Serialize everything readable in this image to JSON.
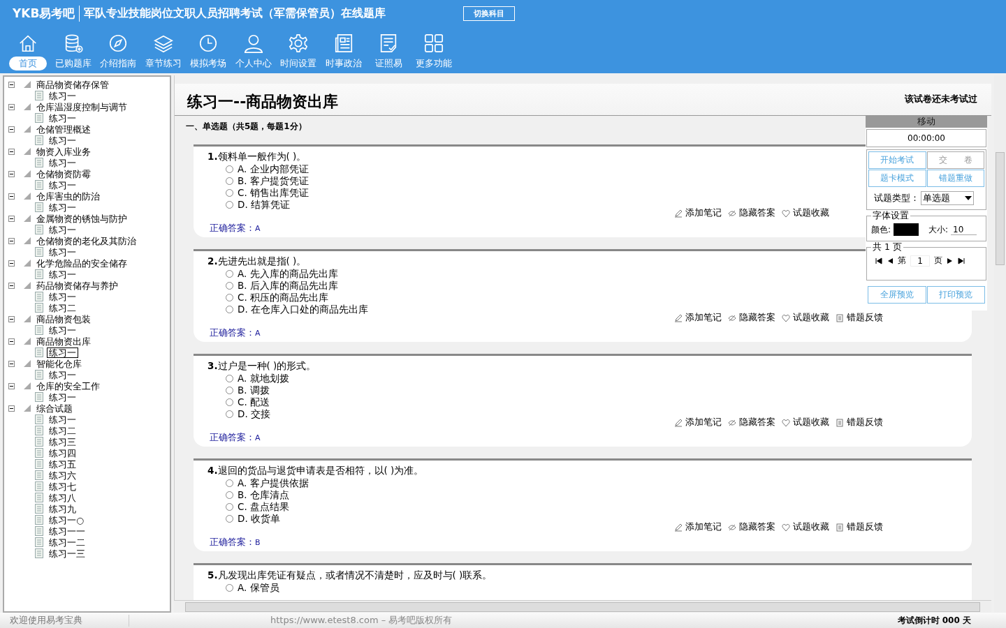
{
  "header": {
    "logo": "YKB易考吧",
    "title": "军队专业技能岗位文职人员招聘考试（军需保管员）在线题库",
    "switch_button": "切换科目"
  },
  "toolbar": [
    {
      "label": "首页",
      "selected": true
    },
    {
      "label": "已购题库",
      "selected": false
    },
    {
      "label": "介绍指南",
      "selected": false
    },
    {
      "label": "章节练习",
      "selected": false
    },
    {
      "label": "模拟考场",
      "selected": false
    },
    {
      "label": "个人中心",
      "selected": false
    },
    {
      "label": "时间设置",
      "selected": false
    },
    {
      "label": "时事政治",
      "selected": false
    },
    {
      "label": "证照易",
      "selected": false
    },
    {
      "label": "更多功能",
      "selected": false
    }
  ],
  "tree": [
    {
      "label": "商品物资储存保管",
      "expanded": true,
      "selected": false,
      "children": [
        {
          "label": "练习一",
          "selected": false
        }
      ]
    },
    {
      "label": "仓库温湿度控制与调节",
      "expanded": true,
      "selected": false,
      "children": [
        {
          "label": "练习一",
          "selected": false
        }
      ]
    },
    {
      "label": "仓储管理概述",
      "expanded": true,
      "selected": false,
      "children": [
        {
          "label": "练习一",
          "selected": false
        }
      ]
    },
    {
      "label": "物资入库业务",
      "expanded": true,
      "selected": false,
      "children": [
        {
          "label": "练习一",
          "selected": false
        }
      ]
    },
    {
      "label": "仓储物资防霉",
      "expanded": true,
      "selected": false,
      "children": [
        {
          "label": "练习一",
          "selected": false
        }
      ]
    },
    {
      "label": "仓库害虫的防治",
      "expanded": true,
      "selected": false,
      "children": [
        {
          "label": "练习一",
          "selected": false
        }
      ]
    },
    {
      "label": "金属物资的锈蚀与防护",
      "expanded": true,
      "selected": false,
      "children": [
        {
          "label": "练习一",
          "selected": false
        }
      ]
    },
    {
      "label": "仓储物资的老化及其防治",
      "expanded": true,
      "selected": false,
      "children": [
        {
          "label": "练习一",
          "selected": false
        }
      ]
    },
    {
      "label": "化学危险品的安全储存",
      "expanded": true,
      "selected": false,
      "children": [
        {
          "label": "练习一",
          "selected": false
        }
      ]
    },
    {
      "label": "药品物资储存与养护",
      "expanded": true,
      "selected": false,
      "children": [
        {
          "label": "练习一",
          "selected": false
        },
        {
          "label": "练习二",
          "selected": false
        }
      ]
    },
    {
      "label": "商品物资包装",
      "expanded": true,
      "selected": false,
      "children": [
        {
          "label": "练习一",
          "selected": false
        }
      ]
    },
    {
      "label": "商品物资出库",
      "expanded": true,
      "selected": false,
      "children": [
        {
          "label": "练习一",
          "selected": true
        }
      ]
    },
    {
      "label": "智能化仓库",
      "expanded": true,
      "selected": false,
      "children": [
        {
          "label": "练习一",
          "selected": false
        }
      ]
    },
    {
      "label": "仓库的安全工作",
      "expanded": true,
      "selected": false,
      "children": [
        {
          "label": "练习一",
          "selected": false
        }
      ]
    },
    {
      "label": "综合试题",
      "expanded": true,
      "selected": false,
      "children": [
        {
          "label": "练习一",
          "selected": false
        },
        {
          "label": "练习二",
          "selected": false
        },
        {
          "label": "练习三",
          "selected": false
        },
        {
          "label": "练习四",
          "selected": false
        },
        {
          "label": "练习五",
          "selected": false
        },
        {
          "label": "练习六",
          "selected": false
        },
        {
          "label": "练习七",
          "selected": false
        },
        {
          "label": "练习八",
          "selected": false
        },
        {
          "label": "练习九",
          "selected": false
        },
        {
          "label": "练习一○",
          "selected": false
        },
        {
          "label": "练习一一",
          "selected": false
        },
        {
          "label": "练习一二",
          "selected": false
        },
        {
          "label": "练习一三",
          "selected": false
        }
      ]
    }
  ],
  "exam": {
    "title": "练习一--商品物资出库",
    "status": "该试卷还未考试过",
    "section": "一、单选题（共5题，每题1分）",
    "questions": [
      {
        "number": "1.",
        "text": "领料单一般作为( )。",
        "options": [
          {
            "text": "A. 企业内部凭证",
            "selected": false
          },
          {
            "text": "B. 客户提货凭证",
            "selected": false
          },
          {
            "text": "C. 销售出库凭证",
            "selected": false
          },
          {
            "text": "D. 结算凭证",
            "selected": false
          }
        ],
        "actions": [
          "添加笔记",
          "隐藏答案",
          "试题收藏"
        ],
        "answer_label": "正确答案：",
        "answer": "A"
      },
      {
        "number": "2.",
        "text": "先进先出就是指( )。",
        "options": [
          {
            "text": "A. 先入库的商品先出库",
            "selected": false
          },
          {
            "text": "B. 后入库的商品先出库",
            "selected": false
          },
          {
            "text": "C. 积压的商品先出库",
            "selected": false
          },
          {
            "text": "D. 在仓库入口处的商品先出库",
            "selected": false
          }
        ],
        "actions": [
          "添加笔记",
          "隐藏答案",
          "试题收藏",
          "错题反馈"
        ],
        "answer_label": "正确答案：",
        "answer": "A"
      },
      {
        "number": "3.",
        "text": "过户是一种( )的形式。",
        "options": [
          {
            "text": "A. 就地划拨",
            "selected": false
          },
          {
            "text": "B. 调拨",
            "selected": false
          },
          {
            "text": "C. 配送",
            "selected": false
          },
          {
            "text": "D. 交接",
            "selected": false
          }
        ],
        "actions": [
          "添加笔记",
          "隐藏答案",
          "试题收藏",
          "错题反馈"
        ],
        "answer_label": "正确答案：",
        "answer": "A"
      },
      {
        "number": "4.",
        "text": "退回的货品与退货申请表是否相符，以( )为准。",
        "options": [
          {
            "text": "A. 客户提供依据",
            "selected": false
          },
          {
            "text": "B. 仓库清点",
            "selected": false
          },
          {
            "text": "C. 盘点结果",
            "selected": false
          },
          {
            "text": "D. 收货单",
            "selected": false
          }
        ],
        "actions": [
          "添加笔记",
          "隐藏答案",
          "试题收藏",
          "错题反馈"
        ],
        "answer_label": "正确答案：",
        "answer": "B"
      },
      {
        "number": "5.",
        "text": "凡发现出库凭证有疑点，或者情况不清楚时，应及时与( )联系。",
        "options": [
          {
            "text": "A. 保管员",
            "selected": false
          }
        ]
      }
    ]
  },
  "panel": {
    "handle": "移动",
    "timer": "00:00:00",
    "buttons": [
      "开始考试",
      "交　　卷",
      "题卡模式",
      "错题重做"
    ],
    "type_label": "试题类型：",
    "type_value": "单选题",
    "font_legend": "字体设置",
    "color_label": "颜色:",
    "color": "#000000",
    "size_label": "大小:",
    "size": "10",
    "pages_legend": "共 1 页",
    "page_prefix": "第",
    "page": "1",
    "page_suffix": "页",
    "preview_buttons": [
      "全屏预览",
      "打印预览"
    ]
  },
  "status_bar": {
    "welcome": "欢迎使用易考宝典",
    "copyright": "https://www.etest8.com – 易考吧版权所有",
    "countdown": "考试倒计时 000 天"
  }
}
